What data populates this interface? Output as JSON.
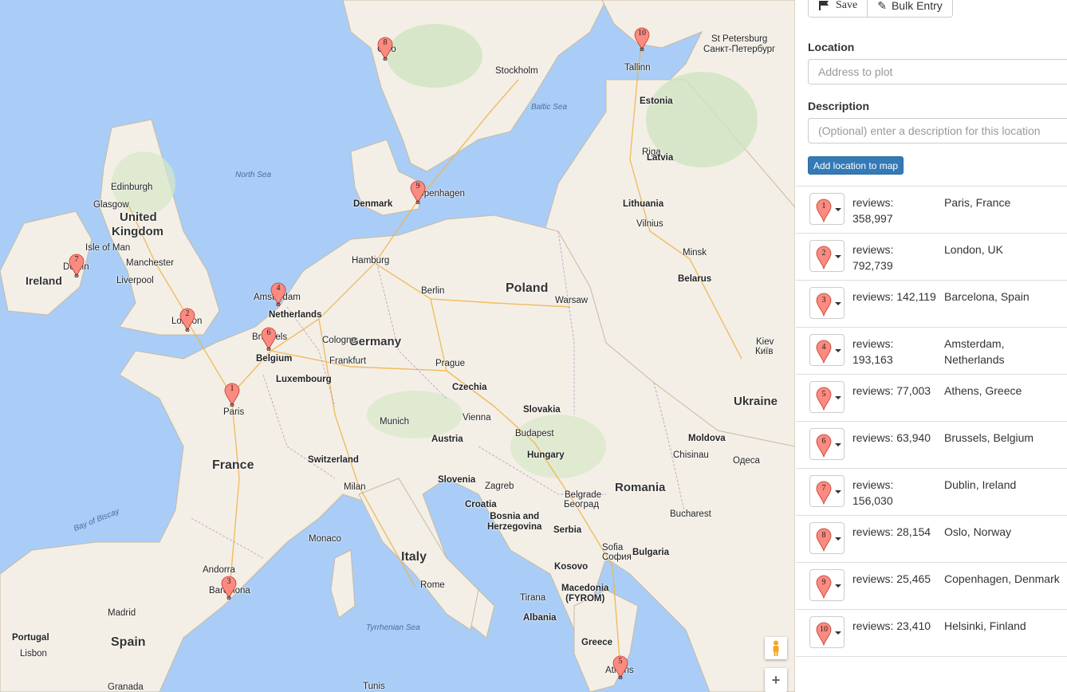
{
  "toolbar": {
    "save_label": "Save",
    "bulk_label": "Bulk Entry"
  },
  "form": {
    "location_label": "Location",
    "location_placeholder": "Address to plot",
    "description_label": "Description",
    "description_placeholder": "(Optional) enter a description for this location",
    "add_button": "Add location to map"
  },
  "locations": [
    {
      "num": "1",
      "reviews": "reviews: 358,997",
      "place": "Paris, France"
    },
    {
      "num": "2",
      "reviews": "reviews: 792,739",
      "place": "London, UK"
    },
    {
      "num": "3",
      "reviews": "reviews: 142,119",
      "place": "Barcelona, Spain"
    },
    {
      "num": "4",
      "reviews": "reviews: 193,163",
      "place": "Amsterdam, Netherlands"
    },
    {
      "num": "5",
      "reviews": "reviews: 77,003",
      "place": "Athens, Greece"
    },
    {
      "num": "6",
      "reviews": "reviews: 63,940",
      "place": "Brussels, Belgium"
    },
    {
      "num": "7",
      "reviews": "reviews: 156,030",
      "place": "Dublin, Ireland"
    },
    {
      "num": "8",
      "reviews": "reviews: 28,154",
      "place": "Oslo, Norway"
    },
    {
      "num": "9",
      "reviews": "reviews: 25,465",
      "place": "Copenhagen, Denmark"
    },
    {
      "num": "10",
      "reviews": "reviews: 23,410",
      "place": "Helsinki, Finland"
    }
  ],
  "map": {
    "labels": {
      "ireland": "Ireland",
      "united_kingdom": "United Kingdom",
      "isle_of_man": "Isle of Man",
      "edinburgh": "Edinburgh",
      "glasgow": "Glasgow",
      "manchester": "Manchester",
      "liverpool": "Liverpool",
      "london": "London",
      "dublin": "Dublin",
      "north_sea": "North Sea",
      "denmark": "Denmark",
      "copenhagen": "Copenhagen",
      "oslo": "Oslo",
      "stockholm": "Stockholm",
      "baltic_sea": "Baltic Sea",
      "riga": "Riga",
      "latvia": "Latvia",
      "estonia": "Estonia",
      "tallinn": "Tallinn",
      "st_petersburg": "St Petersburg",
      "st_petersburg_ru": "Санкт-Петербург",
      "lithuania": "Lithuania",
      "vilnius": "Vilnius",
      "minsk": "Minsk",
      "belarus": "Belarus",
      "poland": "Poland",
      "warsaw": "Warsaw",
      "berlin": "Berlin",
      "hamburg": "Hamburg",
      "germany": "Germany",
      "amsterdam": "Amsterdam",
      "netherlands": "Netherlands",
      "brussels": "Brussels",
      "belgium": "Belgium",
      "cologne": "Cologne",
      "frankfurt": "Frankfurt",
      "luxembourg": "Luxembourg",
      "prague": "Prague",
      "czechia": "Czechia",
      "paris": "Paris",
      "france": "France",
      "bay_of_biscay": "Bay of Biscay",
      "switzerland": "Switzerland",
      "munich": "Munich",
      "vienna": "Vienna",
      "austria": "Austria",
      "slovakia": "Slovakia",
      "budapest": "Budapest",
      "hungary": "Hungary",
      "kiev": "Kiev",
      "kiev_ua": "Київ",
      "ukraine": "Ukraine",
      "moldova": "Moldova",
      "chisinau": "Chisinau",
      "odessa": "Одеса",
      "romania": "Romania",
      "slovenia": "Slovenia",
      "zagreb": "Zagreb",
      "croatia": "Croatia",
      "milan": "Milan",
      "monaco": "Monaco",
      "bosnia": "Bosnia and\nHerzegovina",
      "belgrade": "Belgrade",
      "belgrade_sr": "Београд",
      "serbia": "Serbia",
      "bucharest": "Bucharest",
      "sofia": "Sofia",
      "sofia_bg": "София",
      "bulgaria": "Bulgaria",
      "kosovo": "Kosovo",
      "macedonia": "Macedonia\n(FYROM)",
      "tirana": "Tirana",
      "albania": "Albania",
      "italy": "Italy",
      "rome": "Rome",
      "tyrrhenian_sea": "Tyrrhenian Sea",
      "andorra": "Andorra",
      "barcelona": "Barcelona",
      "spain": "Spain",
      "portugal": "Portugal",
      "madrid": "Madrid",
      "lisbon": "Lisbon",
      "granada": "Granada",
      "tunis": "Tunis",
      "greece": "Greece",
      "athens": "Athens"
    }
  }
}
